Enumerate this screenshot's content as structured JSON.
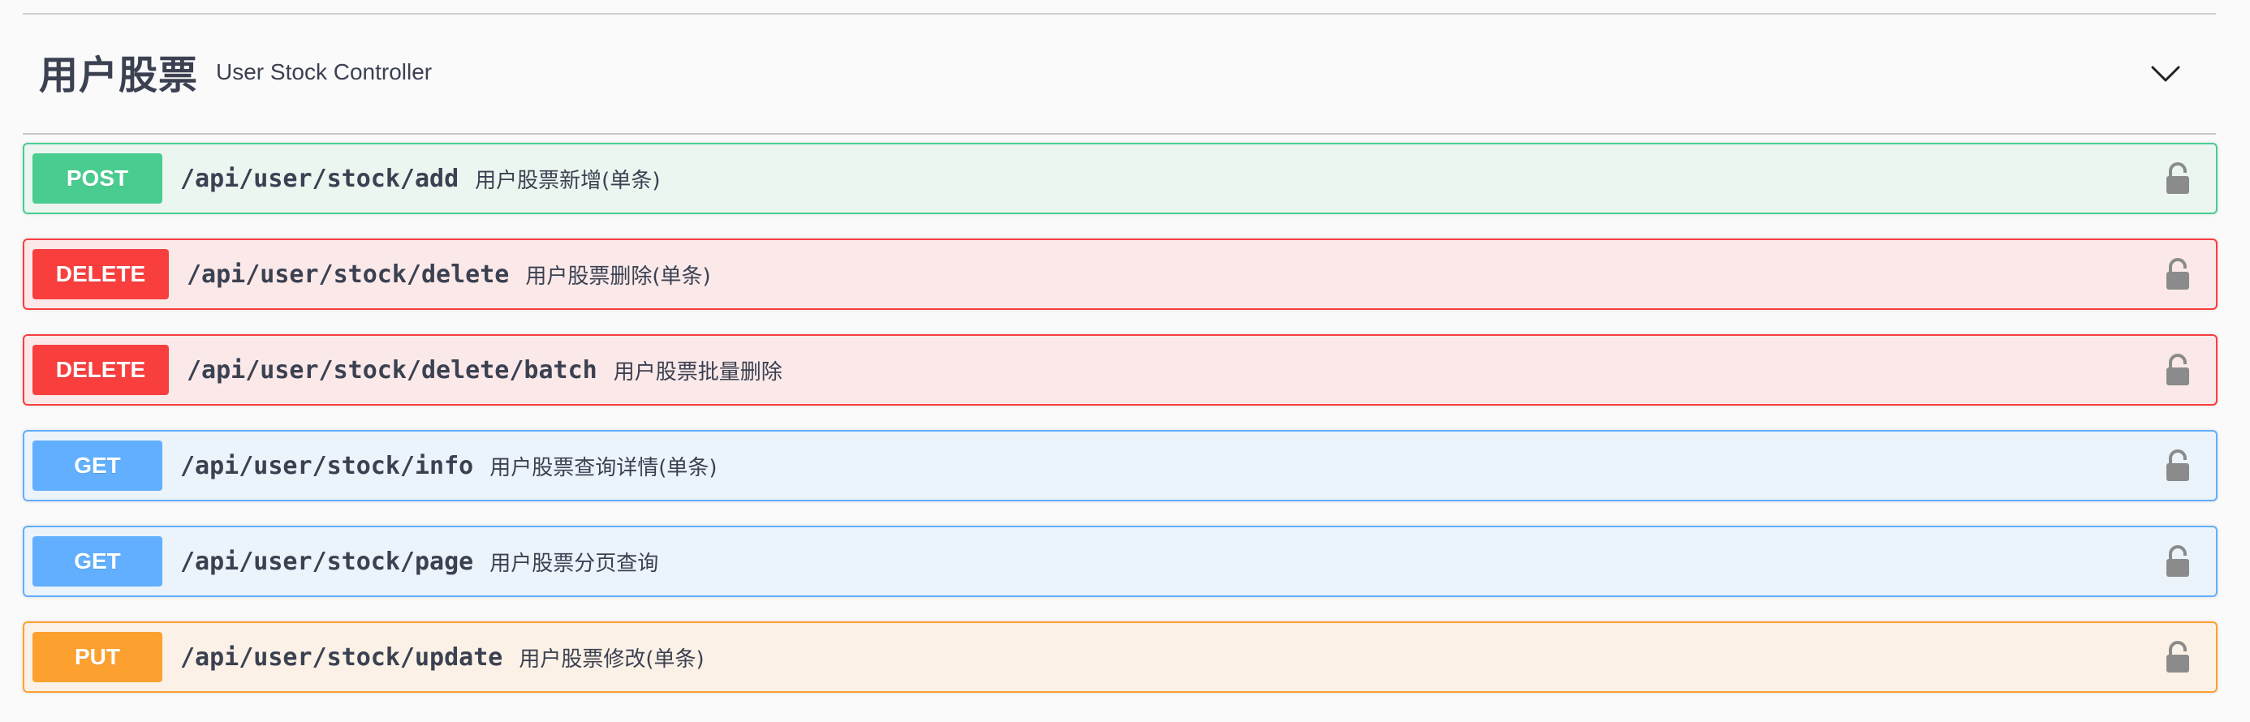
{
  "tag": {
    "name": "用户股票",
    "description": "User Stock Controller",
    "toggle_icon": "chevron-down-icon"
  },
  "operations": [
    {
      "method": "POST",
      "path": "/api/user/stock/add",
      "summary": "用户股票新增(单条)",
      "color": "#49cc90",
      "lock_icon": "lock-icon"
    },
    {
      "method": "DELETE",
      "path": "/api/user/stock/delete",
      "summary": "用户股票删除(单条)",
      "color": "#f93e3e",
      "lock_icon": "lock-icon"
    },
    {
      "method": "DELETE",
      "path": "/api/user/stock/delete/batch",
      "summary": "用户股票批量删除",
      "color": "#f93e3e",
      "lock_icon": "lock-icon"
    },
    {
      "method": "GET",
      "path": "/api/user/stock/info",
      "summary": "用户股票查询详情(单条)",
      "color": "#61affe",
      "lock_icon": "lock-icon"
    },
    {
      "method": "GET",
      "path": "/api/user/stock/page",
      "summary": "用户股票分页查询",
      "color": "#61affe",
      "lock_icon": "lock-icon"
    },
    {
      "method": "PUT",
      "path": "/api/user/stock/update",
      "summary": "用户股票修改(单条)",
      "color": "#fca130",
      "lock_icon": "lock-icon"
    }
  ]
}
